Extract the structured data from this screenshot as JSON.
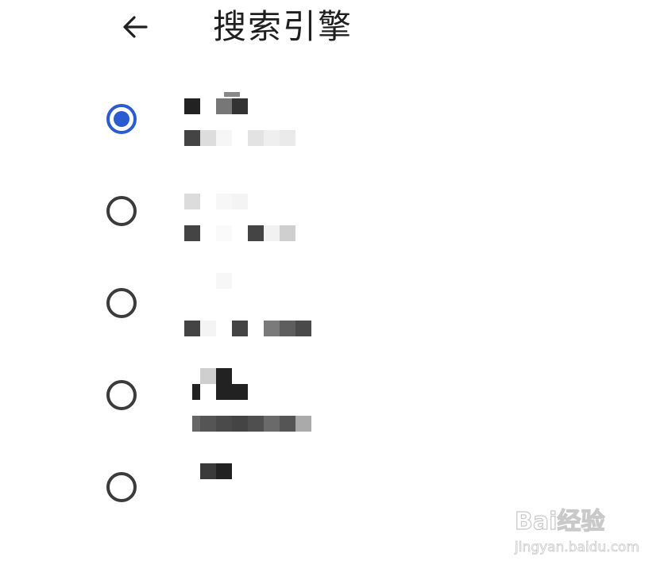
{
  "header": {
    "title": "搜索引擎"
  },
  "options": [
    {
      "selected": true
    },
    {
      "selected": false
    },
    {
      "selected": false
    },
    {
      "selected": false
    },
    {
      "selected": false
    }
  ],
  "watermark": {
    "logo_text": "Bai经验",
    "sub_text": "jingyan.baidu.com"
  },
  "colors": {
    "accent": "#2a5bd1",
    "radio_border": "#3b3b3b",
    "title": "#1f1f1f",
    "background": "#ffffff"
  },
  "icons": {
    "back": "arrow-left-icon"
  }
}
